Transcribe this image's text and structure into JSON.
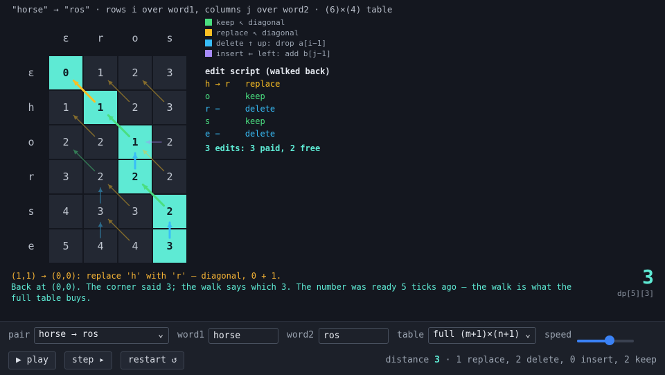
{
  "header": "\"horse\" → \"ros\" · rows i over word1, columns j over word2 · (6)×(4) table",
  "colors": {
    "keep": "#4ade80",
    "replace": "#fbbf24",
    "delete": "#38bdf8",
    "insert": "#a78bfa",
    "path": "#5eead4"
  },
  "table": {
    "col_headers": [
      "ε",
      "r",
      "o",
      "s"
    ],
    "row_headers": [
      "ε",
      "h",
      "o",
      "r",
      "s",
      "e"
    ],
    "values": [
      [
        0,
        1,
        2,
        3
      ],
      [
        1,
        1,
        2,
        3
      ],
      [
        2,
        2,
        1,
        2
      ],
      [
        3,
        2,
        2,
        2
      ],
      [
        4,
        3,
        3,
        2
      ],
      [
        5,
        4,
        4,
        3
      ]
    ],
    "path_cells": [
      [
        0,
        0
      ],
      [
        1,
        1
      ],
      [
        2,
        2
      ],
      [
        3,
        2
      ],
      [
        4,
        3
      ],
      [
        5,
        3
      ]
    ],
    "back_pointers": [
      {
        "from": [
          1,
          1
        ],
        "to": [
          0,
          0
        ],
        "op": "replace",
        "on_path": true
      },
      {
        "from": [
          2,
          2
        ],
        "to": [
          1,
          1
        ],
        "op": "keep",
        "on_path": true
      },
      {
        "from": [
          3,
          2
        ],
        "to": [
          2,
          2
        ],
        "op": "delete",
        "on_path": true
      },
      {
        "from": [
          4,
          3
        ],
        "to": [
          3,
          2
        ],
        "op": "keep",
        "on_path": true
      },
      {
        "from": [
          5,
          3
        ],
        "to": [
          4,
          3
        ],
        "op": "delete",
        "on_path": true
      },
      {
        "from": [
          1,
          2
        ],
        "to": [
          0,
          1
        ],
        "op": "replace",
        "on_path": false
      },
      {
        "from": [
          1,
          3
        ],
        "to": [
          0,
          2
        ],
        "op": "replace",
        "on_path": false
      },
      {
        "from": [
          2,
          1
        ],
        "to": [
          1,
          0
        ],
        "op": "replace",
        "on_path": false
      },
      {
        "from": [
          2,
          3
        ],
        "to": [
          2,
          2
        ],
        "op": "insert",
        "on_path": false
      },
      {
        "from": [
          3,
          1
        ],
        "to": [
          2,
          0
        ],
        "op": "keep",
        "on_path": false
      },
      {
        "from": [
          3,
          3
        ],
        "to": [
          2,
          2
        ],
        "op": "replace",
        "on_path": false
      },
      {
        "from": [
          4,
          1
        ],
        "to": [
          3,
          1
        ],
        "op": "delete",
        "on_path": false
      },
      {
        "from": [
          4,
          2
        ],
        "to": [
          3,
          1
        ],
        "op": "replace",
        "on_path": false
      },
      {
        "from": [
          5,
          1
        ],
        "to": [
          4,
          1
        ],
        "op": "delete",
        "on_path": false
      },
      {
        "from": [
          5,
          2
        ],
        "to": [
          4,
          1
        ],
        "op": "replace",
        "on_path": false
      }
    ]
  },
  "legend": [
    {
      "key": "keep",
      "text": "keep  ↖ diagonal"
    },
    {
      "key": "replace",
      "text": "replace  ↖ diagonal"
    },
    {
      "key": "delete",
      "text": "delete  ↑ up: drop a[i−1]"
    },
    {
      "key": "insert",
      "text": "insert  ← left: add b[j−1]"
    }
  ],
  "script": {
    "title": "edit script (walked back)",
    "lines": [
      {
        "left": "h → r",
        "op": "replace"
      },
      {
        "left": "o    ",
        "op": "keep"
      },
      {
        "left": "r −  ",
        "op": "delete"
      },
      {
        "left": "s    ",
        "op": "keep"
      },
      {
        "left": "e −  ",
        "op": "delete"
      }
    ],
    "summary": "3 edits: 3 paid, 2 free"
  },
  "narration": {
    "line1": "(1,1) → (0,0): replace 'h' with 'r' — diagonal, 0 + 1.",
    "line2": "Back at (0,0). The corner said 3; the walk says which 3. The number was ready 5 ticks ago — the walk is what the full table buys."
  },
  "result": {
    "value": "3",
    "label": "dp[5][3]"
  },
  "controls": {
    "pair_label": "pair",
    "pair_value": "horse → ros",
    "word1_label": "word1",
    "word1_value": "horse",
    "word2_label": "word2",
    "word2_value": "ros",
    "table_label": "table",
    "table_value": "full (m+1)×(n+1)",
    "speed_label": "speed",
    "speed_level": 0.57,
    "play_label": "▶ play",
    "step_label": "step ▸",
    "restart_label": "restart ↺"
  },
  "stats": {
    "distance_label": "distance",
    "distance_value": "3",
    "rest": "· 1 replace, 2 delete, 0 insert, 2 keep"
  }
}
